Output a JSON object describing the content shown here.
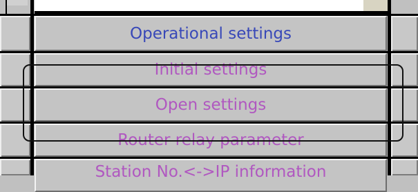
{
  "rows": [
    {
      "label": "Operational settings",
      "color": "#3848b8"
    },
    {
      "label": "Initial settings",
      "color": "#b058c0"
    },
    {
      "label": "Open settings",
      "color": "#b058c0"
    },
    {
      "label": "Router relay parameter",
      "color": "#b058c0"
    },
    {
      "label": "Station No.<->IP information",
      "color": "#b058c0"
    }
  ],
  "colors": {
    "background": "#c0c0c0",
    "highlight_outline": "#111111",
    "selected_text": "#3848b8",
    "item_text": "#b058c0"
  }
}
